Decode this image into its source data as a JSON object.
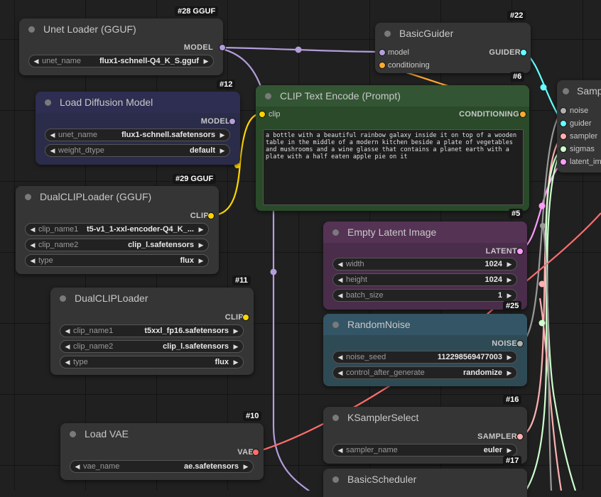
{
  "colors": {
    "background": "#202020",
    "node_body": "#353535",
    "model_socket": "#b39ddb",
    "clip_socket": "#ffd500",
    "conditioning_socket": "#ffa931",
    "guider_socket": "#66ffff",
    "latent_socket": "#ff9cf9",
    "noise_socket": "#b0b0b0",
    "sampler_socket": "#ffb0b0",
    "sigmas_socket": "#cdffcd",
    "vae_socket": "#ff6e6e",
    "clip_text_encode_body": "#335533",
    "empty_latent_body": "#553355",
    "random_noise_body": "#335566",
    "load_diffusion_body": "#2a2a4a"
  },
  "nodes": {
    "unet_loader_gguf": {
      "badge": "#28 GGUF",
      "title": "Unet Loader (GGUF)",
      "output": "MODEL",
      "widgets": [
        {
          "name": "unet_name",
          "value": "flux1-schnell-Q4_K_S.gguf"
        }
      ]
    },
    "load_diffusion_model": {
      "badge": "#12",
      "title": "Load Diffusion Model",
      "output": "MODEL",
      "widgets": [
        {
          "name": "unet_name",
          "value": "flux1-schnell.safetensors"
        },
        {
          "name": "weight_dtype",
          "value": "default"
        }
      ]
    },
    "dualcliploader_gguf": {
      "badge": "#29 GGUF",
      "title": "DualCLIPLoader (GGUF)",
      "output": "CLIP",
      "widgets": [
        {
          "name": "clip_name1",
          "value": "t5-v1_1-xxl-encoder-Q4_K_..."
        },
        {
          "name": "clip_name2",
          "value": "clip_l.safetensors"
        },
        {
          "name": "type",
          "value": "flux"
        }
      ]
    },
    "dualcliploader": {
      "badge": "#11",
      "title": "DualCLIPLoader",
      "output": "CLIP",
      "widgets": [
        {
          "name": "clip_name1",
          "value": "t5xxl_fp16.safetensors"
        },
        {
          "name": "clip_name2",
          "value": "clip_l.safetensors"
        },
        {
          "name": "type",
          "value": "flux"
        }
      ]
    },
    "load_vae": {
      "badge": "#10",
      "title": "Load VAE",
      "output": "VAE",
      "widgets": [
        {
          "name": "vae_name",
          "value": "ae.safetensors"
        }
      ]
    },
    "basic_guider": {
      "badge": "#22",
      "title": "BasicGuider",
      "inputs": [
        "model",
        "conditioning"
      ],
      "output": "GUIDER"
    },
    "clip_text_encode": {
      "badge": "#6",
      "title": "CLIP Text Encode (Prompt)",
      "input": "clip",
      "output": "CONDITIONING",
      "prompt": "a bottle with a beautiful rainbow galaxy inside it on top of a wooden table in the middle of a modern kitchen beside a plate of vegetables and mushrooms and a wine glasse that contains a planet earth with a plate with a half eaten apple pie on it"
    },
    "empty_latent_image": {
      "badge": "#5",
      "title": "Empty Latent Image",
      "output": "LATENT",
      "widgets": [
        {
          "name": "width",
          "value": "1024"
        },
        {
          "name": "height",
          "value": "1024"
        },
        {
          "name": "batch_size",
          "value": "1"
        }
      ]
    },
    "random_noise": {
      "badge": "#25",
      "title": "RandomNoise",
      "output": "NOISE",
      "widgets": [
        {
          "name": "noise_seed",
          "value": "112298569477003"
        },
        {
          "name": "control_after_generate",
          "value": "randomize"
        }
      ]
    },
    "ksampler_select": {
      "badge": "#16",
      "title": "KSamplerSelect",
      "output": "SAMPLER",
      "widgets": [
        {
          "name": "sampler_name",
          "value": "euler"
        }
      ]
    },
    "basic_scheduler": {
      "badge": "#17",
      "title": "BasicScheduler"
    },
    "sampler_custom": {
      "title": "Sampler",
      "inputs": [
        "noise",
        "guider",
        "sampler",
        "sigmas",
        "latent_im"
      ]
    }
  }
}
